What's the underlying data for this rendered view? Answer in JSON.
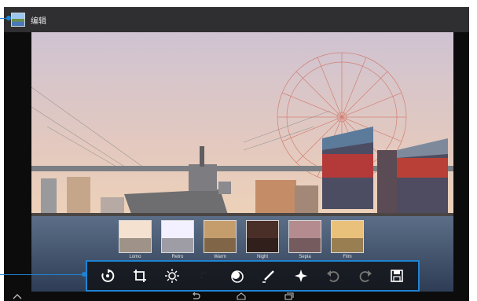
{
  "header": {
    "title": "编辑",
    "app_icon": "gallery-photo-icon"
  },
  "filters": [
    {
      "label": "Lomo",
      "tint": "#f4e1d0"
    },
    {
      "label": "Retro",
      "tint": "#f3f1ff"
    },
    {
      "label": "Warm",
      "tint": "#c59d6d"
    },
    {
      "label": "Night",
      "tint": "#4a2f28"
    },
    {
      "label": "Sepia",
      "tint": "#b48c8f"
    },
    {
      "label": "Film",
      "tint": "#eac17b"
    }
  ],
  "toolbar": {
    "tools": [
      {
        "name": "rotate-icon",
        "color": "#ffffff"
      },
      {
        "name": "crop-icon",
        "color": "#ffffff"
      },
      {
        "name": "brightness-icon",
        "color": "#ffffff"
      },
      {
        "name": "palette-icon",
        "color": "#f07a5a"
      },
      {
        "name": "effects-icon",
        "color": "#ffffff"
      },
      {
        "name": "draw-icon",
        "color": "#ffffff"
      },
      {
        "name": "sparkle-icon",
        "color": "#ffffff"
      },
      {
        "name": "undo-icon",
        "color": "#777777"
      },
      {
        "name": "redo-icon",
        "color": "#777777"
      },
      {
        "name": "save-icon",
        "color": "#ffffff"
      }
    ]
  },
  "nav": {
    "buttons": [
      "up-arrow-icon",
      "back-icon",
      "home-icon",
      "recent-apps-icon"
    ]
  },
  "colors": {
    "accent": "#1e84d4",
    "topbar": "#2f2f31"
  }
}
